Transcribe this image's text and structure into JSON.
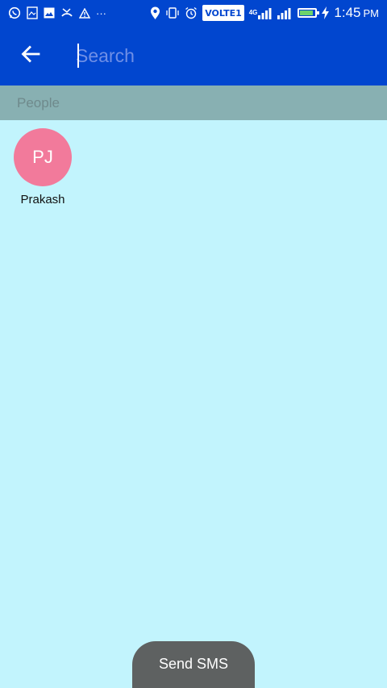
{
  "status_bar": {
    "volte_label": "VOLTE1",
    "network_1": "4G",
    "network_2": "4G",
    "time": "1:45",
    "ampm": "PM",
    "battery_level": 0.85,
    "icons": [
      "whatsapp-icon",
      "gallery-icon",
      "image-icon",
      "missed-call-icon",
      "warning-icon",
      "more-icon",
      "location-icon",
      "vibrate-icon",
      "alarm-icon",
      "signal-icon",
      "battery-icon",
      "charging-icon"
    ]
  },
  "toolbar": {
    "search_placeholder": "Search",
    "search_value": ""
  },
  "section": {
    "title": "People"
  },
  "people": [
    {
      "initials": "PJ",
      "name": "Prakash",
      "avatar_color": "#f27a9b"
    }
  ],
  "send_sms": {
    "label": "Send SMS"
  },
  "colors": {
    "primary": "#0146cf",
    "background": "#c2f4fd",
    "section_header": "#88b0b2",
    "button": "#5e6161"
  }
}
